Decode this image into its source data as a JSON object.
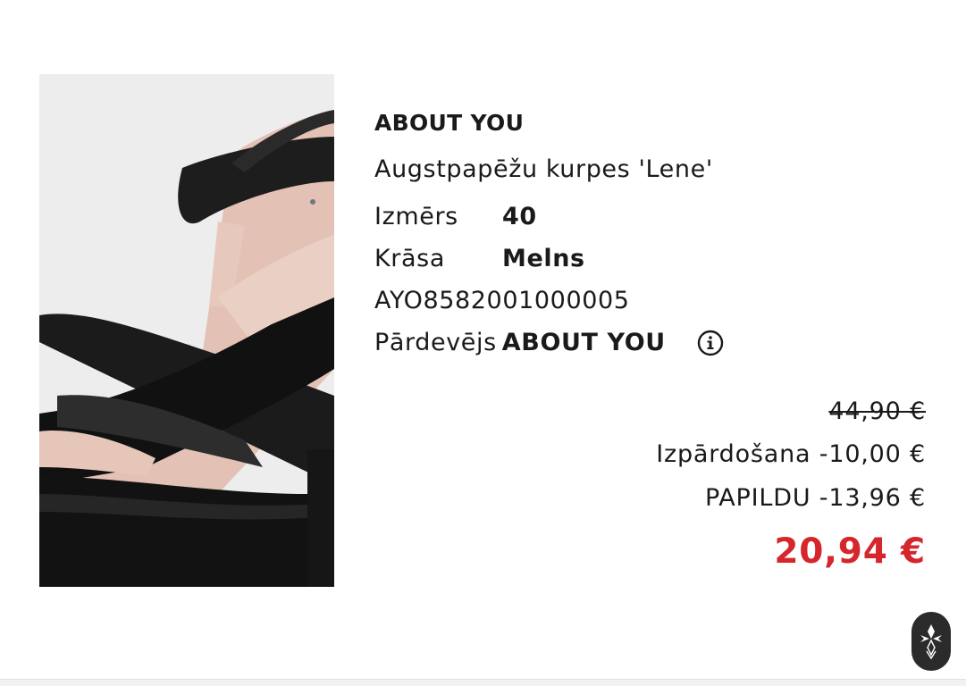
{
  "product": {
    "brand": "ABOUT YOU",
    "name": "Augstpapēžu kurpes 'Lene'",
    "image_icon": "sandal-image"
  },
  "attributes": {
    "size_label": "Izmērs",
    "size_value": "40",
    "color_label": "Krāsa",
    "color_value": "Melns",
    "sku": "AYO8582001000005",
    "seller_label": "Pārdevējs",
    "seller_value": "ABOUT YOU",
    "info_icon": "info-icon"
  },
  "pricing": {
    "original_price": "44,90 €",
    "sale_label": "Izpārdošana",
    "sale_discount": "-10,00 €",
    "extra_label": "PAPILDU",
    "extra_discount": "-13,96 €",
    "final_price": "20,94 €",
    "final_price_color": "#d4262b"
  },
  "floating_button": {
    "icon": "assistant-logo-icon"
  }
}
